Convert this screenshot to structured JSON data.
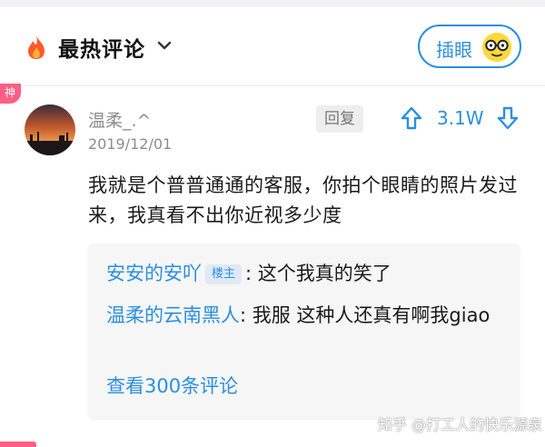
{
  "header": {
    "title": "最热评论",
    "hot_icon": "flame-icon",
    "dropdown_icon": "chevron-down-icon",
    "insert_button_label": "插眼",
    "insert_button_icon": "glasses-face-icon",
    "accent_color": "#2b8fe3"
  },
  "comment": {
    "badge": "神",
    "author": "温柔_.^",
    "date": "2019/12/01",
    "reply_label": "回复",
    "upvote_icon": "arrow-up-icon",
    "vote_count": "3.1W",
    "downvote_icon": "arrow-down-icon",
    "text": "我就是个普普通通的客服，你拍个眼睛的照片发过来，我真看不出你近视多少度"
  },
  "subcomments": {
    "items": [
      {
        "author": "安安的安吖",
        "badge": "楼主",
        "text": ": 这个我真的笑了"
      },
      {
        "author": "温柔的云南黑人",
        "text": ": 我服  这种人还真有啊我giao"
      }
    ],
    "view_more": "查看300条评论"
  },
  "watermark": "知乎 @打工人的快乐源泉"
}
